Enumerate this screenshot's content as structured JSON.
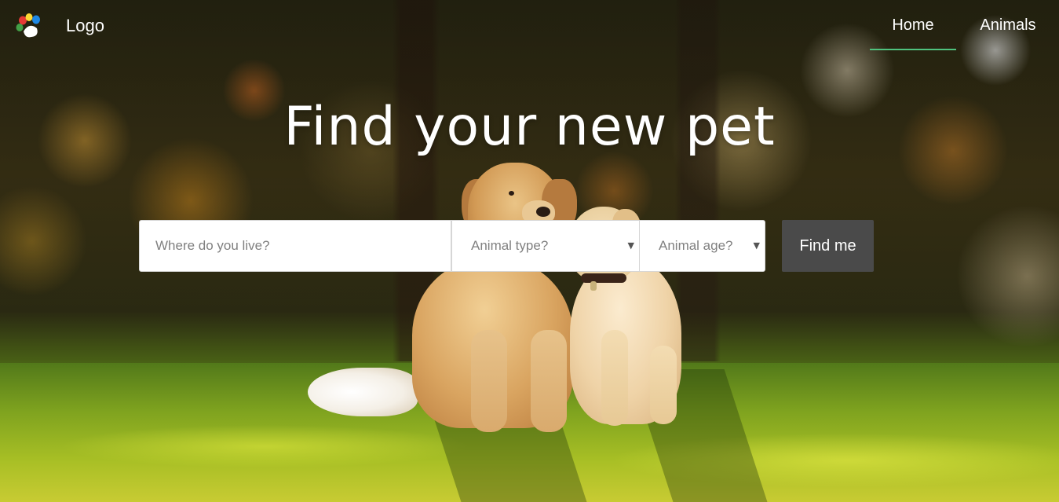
{
  "nav": {
    "logo_text": "Logo",
    "links": [
      {
        "label": "Home",
        "active": true
      },
      {
        "label": "Animals",
        "active": false
      }
    ],
    "active_underline_color": "#4fc27e"
  },
  "hero": {
    "headline": "Find your new pet"
  },
  "search": {
    "location_placeholder": "Where do you live?",
    "animal_type_placeholder": "Animal type?",
    "animal_age_placeholder": "Animal age?",
    "submit_label": "Find me",
    "button_color": "#4a4a4a"
  },
  "icons": {
    "logo": "paw-icon",
    "dropdown": "caret-down-icon"
  }
}
